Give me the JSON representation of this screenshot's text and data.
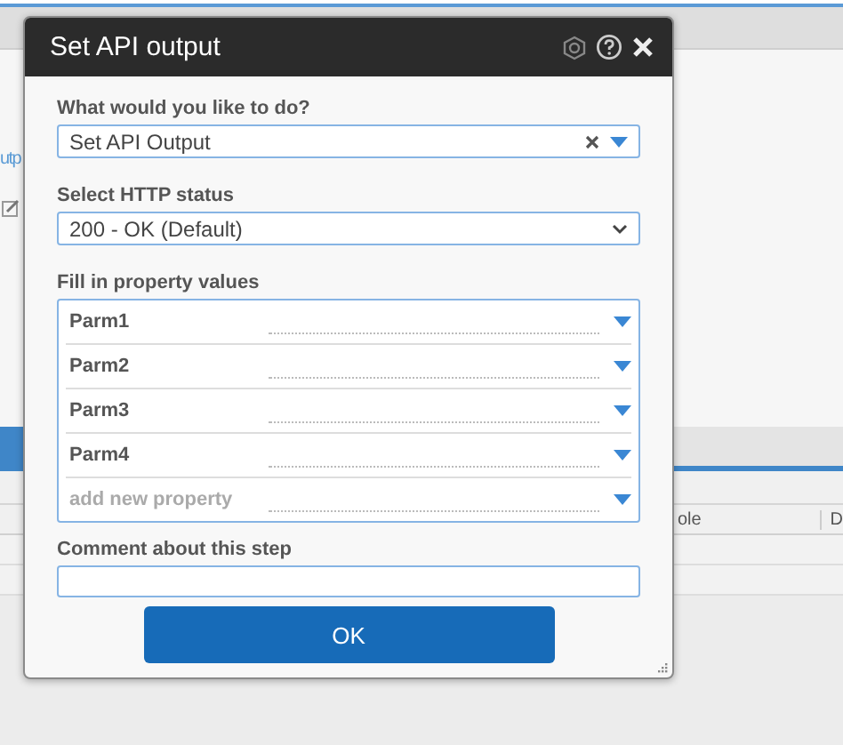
{
  "background": {
    "link_text": "utp",
    "column_headers": [
      "ole",
      "D"
    ]
  },
  "dialog": {
    "title": "Set API output",
    "action": {
      "label": "What would you like to do?",
      "value": "Set API Output"
    },
    "http_status": {
      "label": "Select HTTP status",
      "value": "200 - OK (Default)"
    },
    "properties": {
      "label": "Fill in property values",
      "rows": [
        {
          "name": "Parm1"
        },
        {
          "name": "Parm2"
        },
        {
          "name": "Parm3"
        },
        {
          "name": "Parm4"
        }
      ],
      "new_row": {
        "placeholder": "add new property"
      }
    },
    "comment": {
      "label": "Comment about this step"
    },
    "ok_button": "OK"
  }
}
